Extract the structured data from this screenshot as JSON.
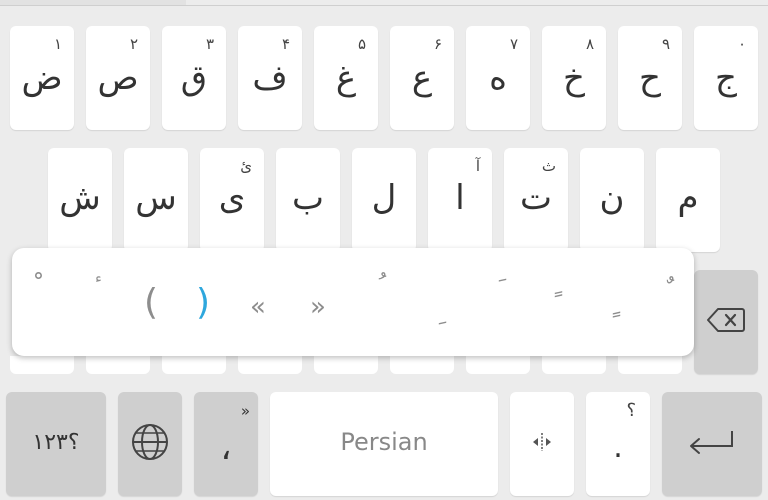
{
  "keyboard": {
    "row1": [
      {
        "main": "ض",
        "hint": "۱"
      },
      {
        "main": "ص",
        "hint": "۲"
      },
      {
        "main": "ق",
        "hint": "۳"
      },
      {
        "main": "ف",
        "hint": "۴"
      },
      {
        "main": "غ",
        "hint": "۵"
      },
      {
        "main": "ع",
        "hint": "۶"
      },
      {
        "main": "ه",
        "hint": "۷"
      },
      {
        "main": "خ",
        "hint": "۸"
      },
      {
        "main": "ح",
        "hint": "۹"
      },
      {
        "main": "ج",
        "hint": "۰"
      }
    ],
    "row2": [
      {
        "main": "ش",
        "hint": ""
      },
      {
        "main": "س",
        "hint": ""
      },
      {
        "main": "ی",
        "hint": "ئ"
      },
      {
        "main": "ب",
        "hint": ""
      },
      {
        "main": "ل",
        "hint": ""
      },
      {
        "main": "ا",
        "hint": "آ"
      },
      {
        "main": "ت",
        "hint": "ث"
      },
      {
        "main": "ن",
        "hint": ""
      },
      {
        "main": "م",
        "hint": ""
      }
    ],
    "popup": {
      "items": [
        "ْ",
        "ٔ",
        "(",
        ")",
        "«",
        "»",
        "ُ",
        "ِ",
        "َ",
        "ٍ",
        "ً",
        "ٌ"
      ],
      "selected_index": 3
    },
    "bottom": {
      "symbols_label": "؟۱۲۳",
      "language_icon": "globe-icon",
      "comma_main": "،",
      "comma_hint": "»",
      "space_label": "Persian",
      "cursor_icon": "cursor-move-icon",
      "period_main": ".",
      "period_hint": "؟",
      "enter_icon": "enter-icon",
      "backspace_icon": "backspace-icon"
    }
  }
}
